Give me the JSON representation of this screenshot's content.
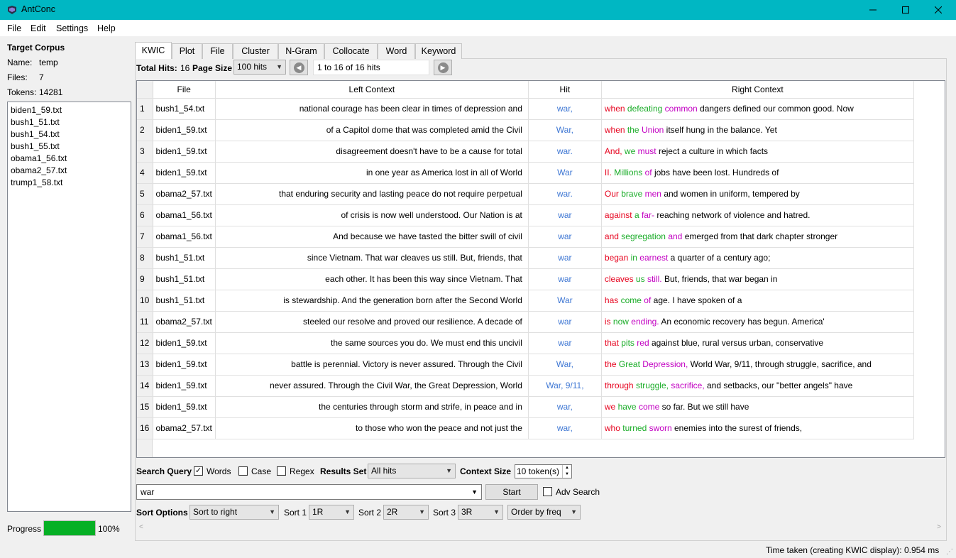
{
  "window": {
    "title": "AntConc",
    "icons": {
      "app": "antconc-app-icon",
      "minimize": "minimize-icon",
      "maximize": "maximize-icon",
      "close": "close-icon"
    },
    "accent": "#00b7c3"
  },
  "menu": {
    "file": "File",
    "edit": "Edit",
    "settings": "Settings",
    "help": "Help"
  },
  "corpus": {
    "title": "Target Corpus",
    "name_label": "Name:",
    "name_value": "temp",
    "files_label": "Files:",
    "files_value": "7",
    "tokens_label": "Tokens:",
    "tokens_value": "14281",
    "files": [
      "biden1_59.txt",
      "bush1_51.txt",
      "bush1_54.txt",
      "bush1_55.txt",
      "obama1_56.txt",
      "obama2_57.txt",
      "trump1_58.txt"
    ]
  },
  "progress": {
    "label": "Progress",
    "value_text": "100%",
    "fraction": 1.0,
    "color": "#06b025"
  },
  "tabs": [
    "KWIC",
    "Plot",
    "File",
    "Cluster",
    "N-Gram",
    "Collocate",
    "Word",
    "Keyword"
  ],
  "active_tab": "KWIC",
  "hits_bar": {
    "total_hits_label": "Total Hits:",
    "total_hits_value": "16",
    "page_size_label": "Page Size",
    "page_size_value": "100 hits",
    "range_text": "1 to 16 of 16 hits",
    "prev_icon": "arrow-left-circle-icon",
    "next_icon": "arrow-right-circle-icon"
  },
  "table": {
    "headers": {
      "num": "",
      "file": "File",
      "left": "Left Context",
      "hit": "Hit",
      "right": "Right Context"
    },
    "colors": {
      "hit": "#3d76d3",
      "red": "#e6041f",
      "green": "#1aac28",
      "purple": "#c200c2"
    },
    "rows": [
      {
        "num": "1",
        "file": "bush1_54.txt",
        "left": "national courage has been clear in times of depression and",
        "hit": "war,",
        "r1": "when",
        "r2": "defeating",
        "r3": "common",
        "rest": "dangers defined our common good. Now"
      },
      {
        "num": "2",
        "file": "biden1_59.txt",
        "left": "of a Capitol dome that was completed amid the Civil",
        "hit": "War,",
        "r1": "when",
        "r2": "the",
        "r3": "Union",
        "rest": "itself hung in the balance. Yet"
      },
      {
        "num": "3",
        "file": "biden1_59.txt",
        "left": "disagreement doesn't have to be a cause for total",
        "hit": "war.",
        "r1": "And,",
        "r2": "we",
        "r3": "must",
        "rest": "reject a culture in which facts"
      },
      {
        "num": "4",
        "file": "biden1_59.txt",
        "left": "in one year as America lost in all of World",
        "hit": "War",
        "r1": "II.",
        "r2": "Millions",
        "r3": "of",
        "rest": "jobs have been lost. Hundreds of"
      },
      {
        "num": "5",
        "file": "obama2_57.txt",
        "left": "that enduring security and lasting peace do not require perpetual",
        "hit": "war.",
        "r1": "Our",
        "r2": "brave",
        "r3": "men",
        "rest": "and women in uniform, tempered by"
      },
      {
        "num": "6",
        "file": "obama1_56.txt",
        "left": "of crisis is now well understood. Our Nation is at",
        "hit": "war",
        "r1": "against",
        "r2": "a",
        "r3": "far-",
        "rest": "reaching network of violence and hatred."
      },
      {
        "num": "7",
        "file": "obama1_56.txt",
        "left": "And because we have tasted the bitter swill of civil",
        "hit": "war",
        "r1": "and",
        "r2": "segregation",
        "r3": "and",
        "rest": "emerged from that dark chapter stronger"
      },
      {
        "num": "8",
        "file": "bush1_51.txt",
        "left": "since Vietnam. That war cleaves us still. But, friends, that",
        "hit": "war",
        "r1": "began",
        "r2": "in",
        "r3": "earnest",
        "rest": "a quarter of a century ago;"
      },
      {
        "num": "9",
        "file": "bush1_51.txt",
        "left": "each other. It has been this way since Vietnam. That",
        "hit": "war",
        "r1": "cleaves",
        "r2": "us",
        "r3": "still.",
        "rest": "But, friends, that war began in"
      },
      {
        "num": "10",
        "file": "bush1_51.txt",
        "left": "is stewardship. And the generation born after the Second World",
        "hit": "War",
        "r1": "has",
        "r2": "come",
        "r3": "of",
        "rest": "age. I have spoken of a"
      },
      {
        "num": "11",
        "file": "obama2_57.txt",
        "left": "steeled our resolve and proved our resilience. A decade of",
        "hit": "war",
        "r1": "is",
        "r2": "now",
        "r3": "ending.",
        "rest": "An economic recovery has begun. America'"
      },
      {
        "num": "12",
        "file": "biden1_59.txt",
        "left": "the same sources you do. We must end this uncivil",
        "hit": "war",
        "r1": "that",
        "r2": "pits",
        "r3": "red",
        "rest": "against blue, rural versus urban, conservative"
      },
      {
        "num": "13",
        "file": "biden1_59.txt",
        "left": "battle is perennial. Victory is never assured. Through the Civil",
        "hit": "War,",
        "r1": "the",
        "r2": "Great",
        "r3": "Depression,",
        "rest": "World War, 9/11, through struggle, sacrifice, and"
      },
      {
        "num": "14",
        "file": "biden1_59.txt",
        "left": "never assured. Through the Civil War, the Great Depression, World",
        "hit": "War, 9/11,",
        "r1": "through",
        "r2": "struggle,",
        "r3": "sacrifice,",
        "rest": "and setbacks, our \"better angels\" have"
      },
      {
        "num": "15",
        "file": "biden1_59.txt",
        "left": "the centuries through storm and strife, in peace and in",
        "hit": "war,",
        "r1": "we",
        "r2": "have",
        "r3": "come",
        "rest": "so far. But we still have"
      },
      {
        "num": "16",
        "file": "obama2_57.txt",
        "left": "to those who won the peace and not just the",
        "hit": "war,",
        "r1": "who",
        "r2": "turned",
        "r3": "sworn",
        "rest": "enemies into the surest of friends,"
      }
    ]
  },
  "search": {
    "query_label": "Search Query",
    "words_label": "Words",
    "words_checked": true,
    "case_label": "Case",
    "case_checked": false,
    "regex_label": "Regex",
    "regex_checked": false,
    "results_set_label": "Results Set",
    "results_set_value": "All hits",
    "context_size_label": "Context Size",
    "context_size_value": "10 token(s)",
    "query_value": "war",
    "start_label": "Start",
    "adv_search_label": "Adv Search",
    "adv_search_checked": false
  },
  "sort": {
    "options_label": "Sort Options",
    "main_value": "Sort to right",
    "sort1_label": "Sort 1",
    "sort1_value": "1R",
    "sort2_label": "Sort 2",
    "sort2_value": "2R",
    "sort3_label": "Sort 3",
    "sort3_value": "3R",
    "order_value": "Order by freq"
  },
  "status": {
    "text": "Time taken (creating KWIC display):  0.954 ms"
  }
}
